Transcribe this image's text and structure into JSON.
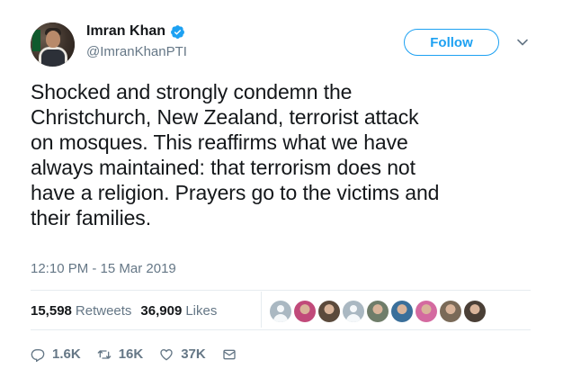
{
  "author": {
    "name": "Imran Khan",
    "handle": "@ImranKhanPTI",
    "verified": true
  },
  "follow_label": "Follow",
  "tweet_text": "Shocked and strongly condemn the\nChristchurch, New Zealand, terrorist attack\non mosques. This reaffirms what we have\nalways maintained: that terrorism does not\nhave a religion. Prayers go to the victims and\ntheir families.",
  "timestamp": "12:10 PM - 15 Mar 2019",
  "stats": {
    "retweets_count": "15,598",
    "retweets_label": "Retweets",
    "likes_count": "36,909",
    "likes_label": "Likes"
  },
  "actions": {
    "replies": "1.6K",
    "retweets": "16K",
    "likes": "37K"
  },
  "liker_avatars": [
    {
      "type": "default",
      "color": "#aab8c2"
    },
    {
      "type": "photo",
      "color": "#c14a7a"
    },
    {
      "type": "photo",
      "color": "#5b4a3c"
    },
    {
      "type": "default",
      "color": "#aab8c2"
    },
    {
      "type": "photo",
      "color": "#6f7d6a"
    },
    {
      "type": "photo",
      "color": "#3a6f9a"
    },
    {
      "type": "photo",
      "color": "#d46aa0"
    },
    {
      "type": "photo",
      "color": "#7a6a58"
    },
    {
      "type": "photo",
      "color": "#4a3f36"
    }
  ],
  "colors": {
    "accent": "#1da1f2",
    "text": "#14171a",
    "muted": "#657786",
    "divider": "#e6ecf0"
  }
}
